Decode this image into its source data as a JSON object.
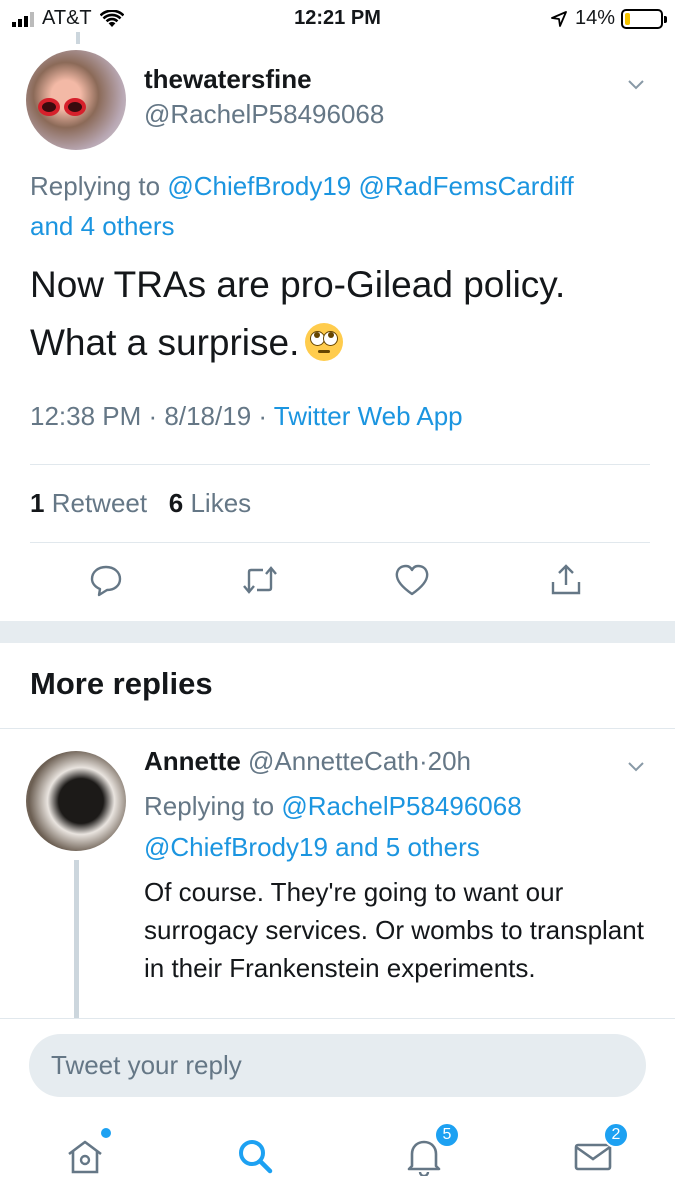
{
  "status_bar": {
    "carrier": "AT&T",
    "time": "12:21 PM",
    "battery_percent": "14%",
    "battery_level": 0.14,
    "icons": [
      "signal-icon",
      "wifi-icon",
      "location-icon",
      "battery-icon"
    ]
  },
  "main_tweet": {
    "display_name": "thewatersfine",
    "handle": "@RachelP58496068",
    "replying_prefix": "Replying to ",
    "replying_user_1": "@ChiefBrody19",
    "replying_user_2": "@RadFemsCardiff",
    "replying_others": "and 4 others",
    "text_line_1": "Now TRAs are pro-Gilead policy.",
    "text_line_2": "What a surprise.",
    "emoji": "face-with-rolling-eyes",
    "time": "12:38 PM",
    "sep_1": " · ",
    "date": "8/18/19",
    "sep_2": " · ",
    "source": "Twitter Web App",
    "retweet_count": "1",
    "retweet_label": "Retweet",
    "like_count": "6",
    "like_label": "Likes",
    "actions": [
      "reply-icon",
      "retweet-icon",
      "like-icon",
      "share-icon"
    ]
  },
  "more_replies": {
    "heading": "More replies"
  },
  "reply_tweet": {
    "display_name": "Annette",
    "handle": "@AnnetteCath",
    "time_sep": "·",
    "age": "20h",
    "replying_prefix": "Replying to ",
    "replying_user_1": "@RachelP58496068",
    "replying_user_2": "@ChiefBrody19",
    "replying_others": "and 5 others",
    "text": "Of course. They're going to want our surrogacy services. Or wombs to transplant in their Frankenstein experiments."
  },
  "compose": {
    "placeholder": "Tweet your reply"
  },
  "tab_bar": {
    "items": [
      {
        "icon": "home-icon",
        "badge": ""
      },
      {
        "icon": "search-icon",
        "badge": ""
      },
      {
        "icon": "notifications-icon",
        "badge": "5"
      },
      {
        "icon": "messages-icon",
        "badge": "2"
      }
    ],
    "accent_color": "#1da1f2"
  },
  "colors": {
    "link": "#1b95e0",
    "secondary_text": "#657786",
    "primary_text": "#14171a"
  }
}
